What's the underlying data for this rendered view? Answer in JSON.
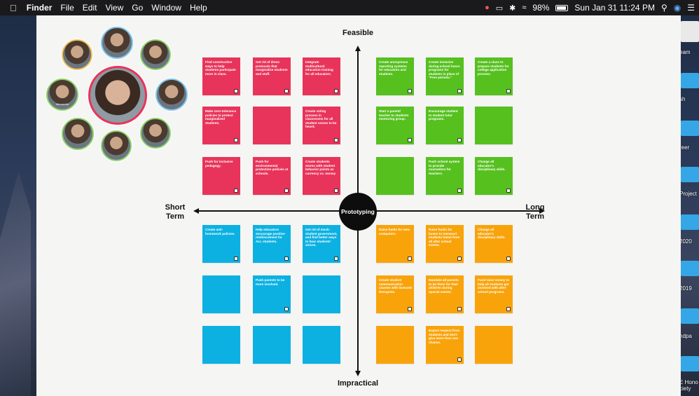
{
  "menubar": {
    "apple": "",
    "items": [
      "Finder",
      "File",
      "Edit",
      "View",
      "Go",
      "Window",
      "Help"
    ],
    "battery": "98%",
    "datetime": "Sun Jan 31  11:24 PM"
  },
  "desktop_labels": [
    "eam",
    "sh",
    "reer",
    "Project",
    "2020",
    "2019",
    "ndpa",
    "E Hono ciety"
  ],
  "board": {
    "axis_top": "Feasible",
    "axis_bottom": "Impractical",
    "axis_left": "Short Term",
    "axis_right": "Long Term",
    "center": "Prototyping"
  },
  "notes": {
    "red": [
      "Find constructive ways to help students participate more in class.",
      "Get rid of dress protocols that marginalize students and staff.",
      "Integrate multicultural education training for all educators.",
      "Make zero-tolerance policies to protect marginalized students.",
      "",
      "Create voting process in classrooms for all student voices to be heard.",
      "Push for inclusive pedagogy.",
      "Push for environmental protection policies at schools.",
      "Create students stores with student behavior points as currency vs. money"
    ],
    "green": [
      "Create anonymous reporting systems for educators and students.",
      "Create inclusive during-school hours programs for students in place of \"Free periods.\"",
      "Create a class to prepare students for college application process.",
      "Start a parent/ teacher to students mentoring group.",
      "Encourage student to student tutor programs.",
      "",
      "",
      "Push school system to provide counselors for teachers.",
      "Change all educator's disciplinary skills."
    ],
    "blue": [
      "Create anti-homework policies.",
      "Help educators encourage positive reinforcement for ALL students.",
      "Get rid of mock-student government, and find better ways to hear students' voices.",
      "",
      "Push parents to be more involved.",
      "",
      "",
      "",
      ""
    ],
    "orange": [
      "Raise funds for new computers.",
      "Raise funds for buses to transport students home from all after school events.",
      "Change all educator's disciplinary skills.",
      "Create student communication classes with licensed therapists.",
      "Mandate all parents to be there for their children during special events.",
      "Fund raise money to help all students get involved with after-school programs.",
      "",
      "Expect respect from students and don't give more than one chance.",
      ""
    ]
  },
  "participants": [
    "Alexandra",
    "",
    "",
    "",
    "",
    "",
    "",
    "",
    ""
  ]
}
